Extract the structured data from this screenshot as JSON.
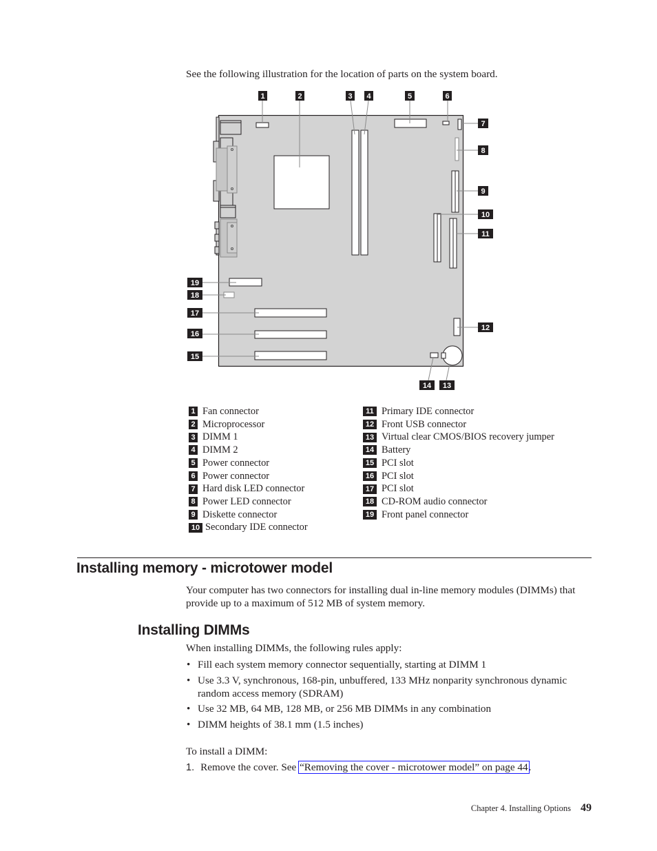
{
  "intro_text": "See the following illustration for the location of parts on the system board.",
  "diagram": {
    "callouts": [
      "1",
      "2",
      "3",
      "4",
      "5",
      "6",
      "7",
      "8",
      "9",
      "10",
      "11",
      "12",
      "13",
      "14",
      "15",
      "16",
      "17",
      "18",
      "19"
    ],
    "colors": {
      "board": "#d3d3d3",
      "outline": "#231f20",
      "leader": "#8a8a8a",
      "badge": "#231f20"
    }
  },
  "legend": {
    "left": [
      {
        "num": "1",
        "label": "Fan connector"
      },
      {
        "num": "2",
        "label": "Microprocessor"
      },
      {
        "num": "3",
        "label": "DIMM 1"
      },
      {
        "num": "4",
        "label": "DIMM 2"
      },
      {
        "num": "5",
        "label": "Power connector"
      },
      {
        "num": "6",
        "label": "Power connector"
      },
      {
        "num": "7",
        "label": "Hard disk LED connector"
      },
      {
        "num": "8",
        "label": "Power LED connector"
      },
      {
        "num": "9",
        "label": "Diskette connector"
      },
      {
        "num": "10",
        "label": "Secondary IDE connector"
      }
    ],
    "right": [
      {
        "num": "11",
        "label": "Primary IDE connector"
      },
      {
        "num": "12",
        "label": "Front USB connector"
      },
      {
        "num": "13",
        "label": "Virtual clear CMOS/BIOS recovery jumper"
      },
      {
        "num": "14",
        "label": "Battery"
      },
      {
        "num": "15",
        "label": "PCI slot"
      },
      {
        "num": "16",
        "label": "PCI slot"
      },
      {
        "num": "17",
        "label": "PCI slot"
      },
      {
        "num": "18",
        "label": "CD-ROM audio connector"
      },
      {
        "num": "19",
        "label": "Front panel connector"
      }
    ]
  },
  "section": {
    "heading": "Installing memory - microtower model",
    "paragraph": "Your computer has two connectors for installing dual in-line memory modules (DIMMs) that provide up to a maximum of 512 MB of system memory."
  },
  "subsection": {
    "heading": "Installing DIMMs",
    "rules_intro": "When installing DIMMs, the following rules apply:",
    "bullet_glyph": "•",
    "rules": [
      "Fill each system memory connector sequentially, starting at DIMM 1",
      "Use 3.3 V, synchronous, 168-pin, unbuffered, 133 MHz nonparity synchronous dynamic random access memory (SDRAM)",
      "Use 32 MB, 64 MB, 128 MB, or 256 MB DIMMs in any combination",
      "DIMM heights of 38.1 mm (1.5 inches)"
    ],
    "to_install": "To install a DIMM:",
    "steps": [
      {
        "num": "1.",
        "text": "Remove the cover. See ",
        "link": "“Removing the cover - microtower model” on page 44",
        "after": "."
      }
    ]
  },
  "footer": {
    "chapter": "Chapter 4. Installing Options",
    "page_number": "49"
  }
}
